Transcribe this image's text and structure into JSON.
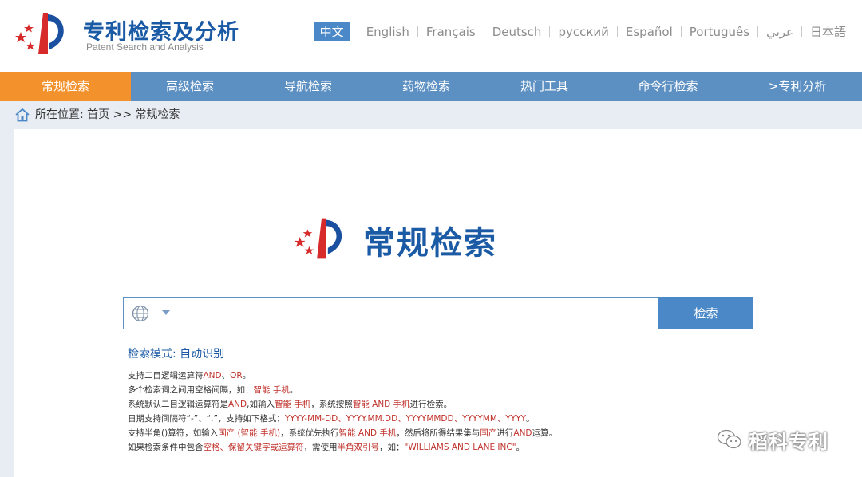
{
  "header": {
    "title": "专利检索及分析",
    "subtitle": "Patent Search and Analysis",
    "languages": [
      {
        "label": "中文",
        "active": true
      },
      {
        "label": "English"
      },
      {
        "label": "Français"
      },
      {
        "label": "Deutsch"
      },
      {
        "label": "русский"
      },
      {
        "label": "Español"
      },
      {
        "label": "Português"
      },
      {
        "label": "عربي"
      },
      {
        "label": "日本語"
      }
    ]
  },
  "nav": {
    "items": [
      {
        "label": "常规检索",
        "active": true
      },
      {
        "label": "高级检索"
      },
      {
        "label": "导航检索"
      },
      {
        "label": "药物检索"
      },
      {
        "label": "热门工具"
      },
      {
        "label": "命令行检索"
      },
      {
        "label": ">专利分析"
      }
    ]
  },
  "breadcrumb": {
    "text": "所在位置: 首页 >> 常规检索"
  },
  "main": {
    "title": "常规检索",
    "search": {
      "value": "",
      "placeholder": "",
      "button_label": "检索"
    },
    "mode": "检索模式: 自动识别",
    "tips": [
      [
        {
          "t": "支持二目逻辑运算符"
        },
        {
          "t": "AND",
          "r": 1
        },
        {
          "t": "、"
        },
        {
          "t": "OR",
          "r": 1
        },
        {
          "t": "。"
        }
      ],
      [
        {
          "t": "多个检索词之间用空格间隔，如："
        },
        {
          "t": "智能 手机",
          "r": 1
        },
        {
          "t": "。"
        }
      ],
      [
        {
          "t": "系统默认二目逻辑运算符是"
        },
        {
          "t": "AND",
          "r": 1
        },
        {
          "t": ",如输入"
        },
        {
          "t": "智能 手机",
          "r": 1
        },
        {
          "t": "，系统按照"
        },
        {
          "t": "智能 AND 手机",
          "r": 1
        },
        {
          "t": "进行检索。"
        }
      ],
      [
        {
          "t": "日期支持间隔符“-”、“.”，支持如下格式："
        },
        {
          "t": "YYYY-MM-DD、YYYY.MM.DD、YYYYMMDD、YYYYMM、YYYY",
          "r": 1
        },
        {
          "t": "。"
        }
      ],
      [
        {
          "t": "支持半角()算符，如输入"
        },
        {
          "t": "国产 (智能 手机)",
          "r": 1
        },
        {
          "t": "，系统优先执行"
        },
        {
          "t": "智能 AND 手机",
          "r": 1
        },
        {
          "t": "，然后将所得结果集与"
        },
        {
          "t": "国产",
          "r": 1
        },
        {
          "t": "进行"
        },
        {
          "t": "AND",
          "r": 1
        },
        {
          "t": "运算。"
        }
      ],
      [
        {
          "t": "如果检索条件中包含"
        },
        {
          "t": "空格、保留关键字或运算符",
          "r": 1
        },
        {
          "t": "，需使用"
        },
        {
          "t": "半角双引号",
          "r": 1
        },
        {
          "t": "，如："
        },
        {
          "t": "\"WILLIAMS AND LANE INC\"",
          "r": 1
        },
        {
          "t": "。"
        }
      ]
    ]
  },
  "watermark": {
    "text": "稻科专利"
  },
  "colors": {
    "brand_blue": "#1b5aa5",
    "nav_blue": "#5c8fc2",
    "active_orange": "#f3922c",
    "tip_red": "#c0312b"
  }
}
